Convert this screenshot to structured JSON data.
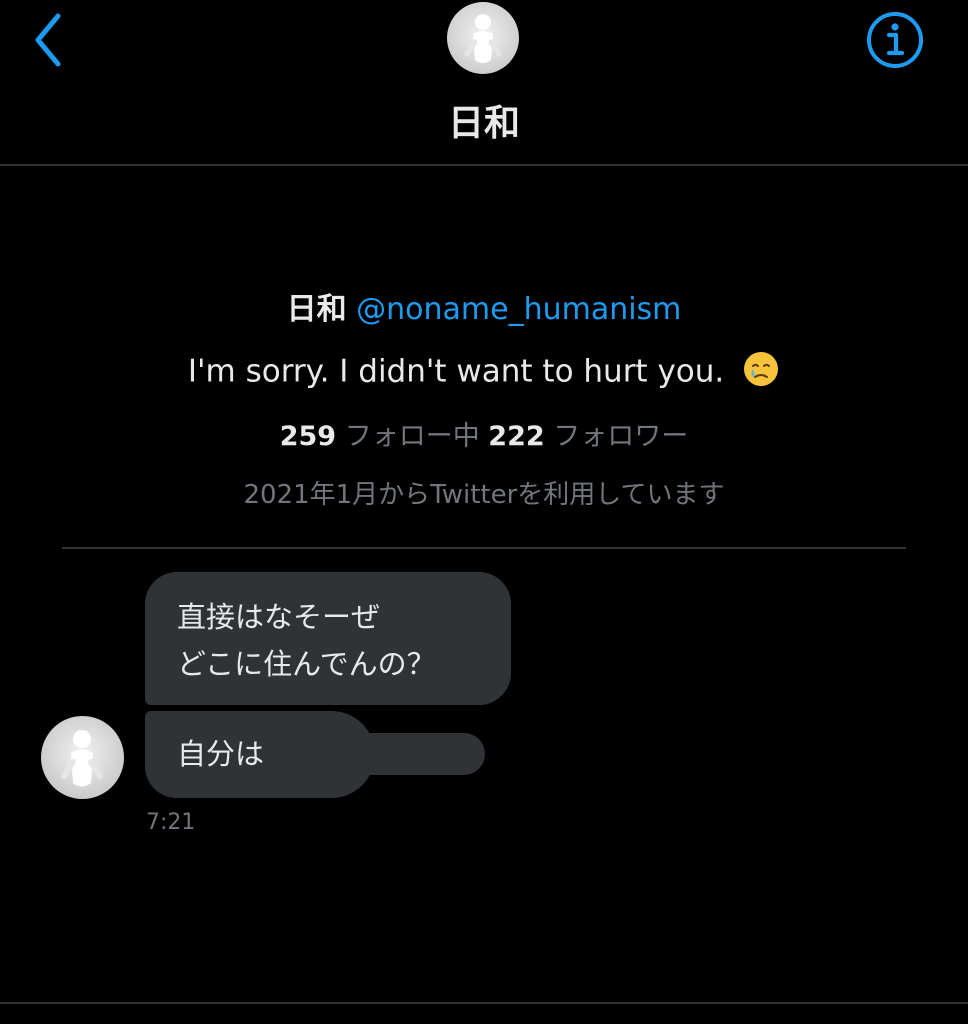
{
  "header": {
    "title": "日和"
  },
  "profile": {
    "name": "日和",
    "handle": "@noname_humanism",
    "bio": "I'm sorry. I didn't want to hurt you.",
    "bio_emoji": "face-holding-back-tears-emoji",
    "following_count": "259",
    "following_label": "フォロー中",
    "followers_count": "222",
    "followers_label": "フォロワー",
    "joined": "2021年1月からTwitterを利用しています"
  },
  "messages": [
    {
      "lines": [
        "直接はなそーぜ",
        "どこに住んでんの？"
      ]
    },
    {
      "text": "自分は"
    }
  ],
  "message_time": "7:21",
  "colors": {
    "accent": "#1d9bf0",
    "background": "#000000",
    "bubble": "#2f3336",
    "secondary_text": "#71767b"
  },
  "icons": [
    "back-chevron-icon",
    "info-icon",
    "avatar"
  ]
}
